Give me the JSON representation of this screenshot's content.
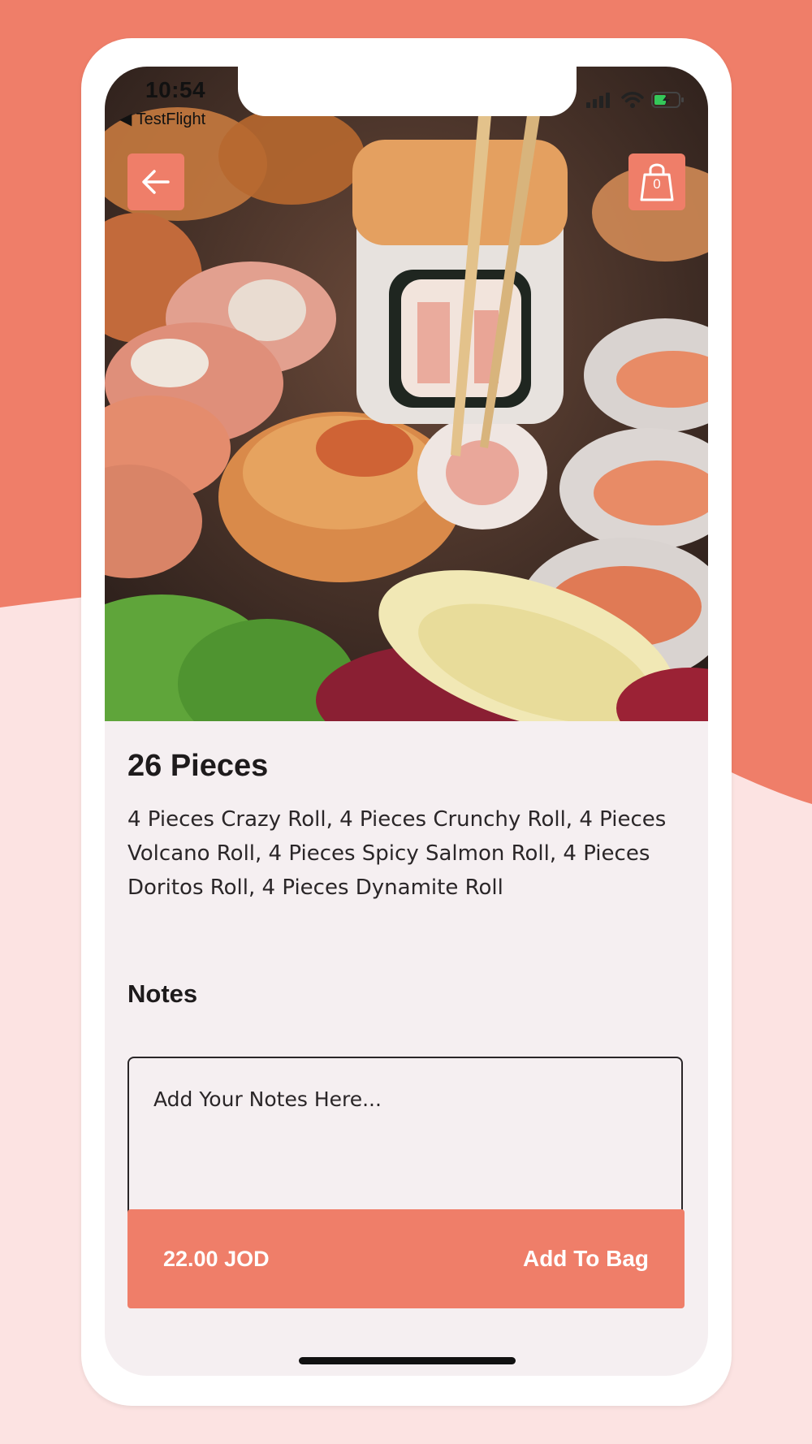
{
  "status_bar": {
    "time": "10:54",
    "back_label": "◀ TestFlight"
  },
  "header": {
    "back_icon": "arrow-left-icon",
    "bag_icon": "shopping-bag-icon",
    "bag_count": "0"
  },
  "product": {
    "title": "26 Pieces",
    "description": "4 Pieces Crazy Roll, 4 Pieces Crunchy Roll, 4 Pieces Volcano Roll, 4 Pieces Spicy Salmon Roll, 4 Pieces Doritos Roll, 4 Pieces Dynamite Roll",
    "image": "sushi-rolls-photo"
  },
  "notes": {
    "label": "Notes",
    "placeholder": "Add Your Notes Here..."
  },
  "bottom_bar": {
    "price": "22.00 JOD",
    "add_label": "Add To Bag"
  },
  "colors": {
    "accent": "#ef7e69",
    "background_light": "#fce3e2",
    "screen_background": "#f5eff1"
  }
}
